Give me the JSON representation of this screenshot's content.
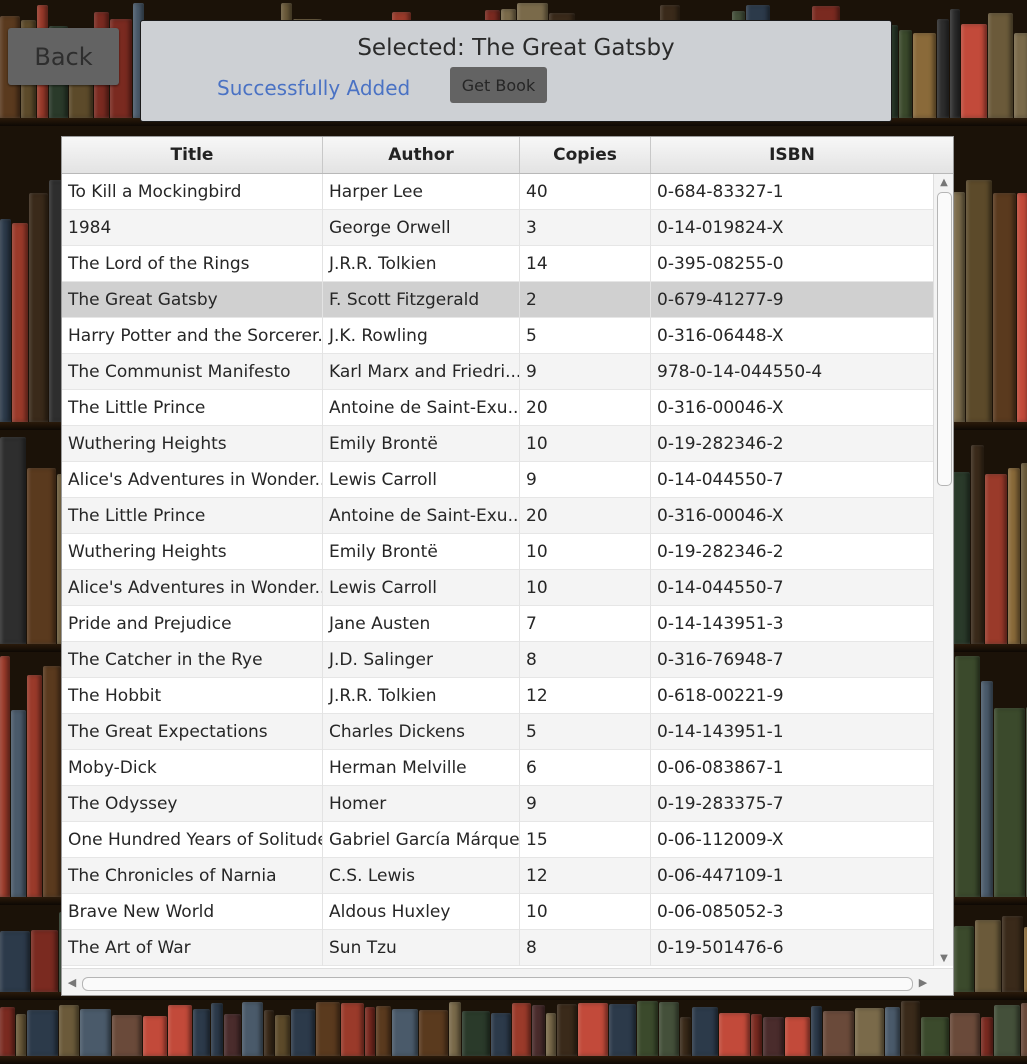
{
  "window": {
    "back_label": "Back",
    "selected_text": "Selected: The Great Gatsby",
    "status_message": "Successfully Added",
    "get_book_label": "Get Book",
    "status_color": "#4a72c4"
  },
  "table": {
    "columns": [
      "Title",
      "Author",
      "Copies",
      "ISBN"
    ],
    "selected_index": 3,
    "rows": [
      {
        "title": "To Kill a Mockingbird",
        "author": "Harper Lee",
        "copies": "40",
        "isbn": "0-684-83327-1"
      },
      {
        "title": "1984",
        "author": "George Orwell",
        "copies": "3",
        "isbn": "0-14-019824-X"
      },
      {
        "title": "The Lord of the Rings",
        "author": "J.R.R. Tolkien",
        "copies": "14",
        "isbn": "0-395-08255-0"
      },
      {
        "title": "The Great Gatsby",
        "author": "F. Scott Fitzgerald",
        "copies": "2",
        "isbn": "0-679-41277-9"
      },
      {
        "title": "Harry Potter and the Sorcerer...",
        "author": "J.K. Rowling",
        "copies": "5",
        "isbn": "0-316-06448-X"
      },
      {
        "title": "The Communist Manifesto",
        "author": "Karl Marx and Friedri...",
        "copies": "9",
        "isbn": "978-0-14-044550-4"
      },
      {
        "title": "The Little Prince",
        "author": "Antoine de Saint-Exu...",
        "copies": "20",
        "isbn": "0-316-00046-X"
      },
      {
        "title": "Wuthering Heights",
        "author": "Emily Brontë",
        "copies": "10",
        "isbn": "0-19-282346-2"
      },
      {
        "title": "Alice's Adventures in Wonder...",
        "author": "Lewis Carroll",
        "copies": "9",
        "isbn": "0-14-044550-7"
      },
      {
        "title": "The Little Prince",
        "author": "Antoine de Saint-Exu...",
        "copies": "20",
        "isbn": "0-316-00046-X"
      },
      {
        "title": "Wuthering Heights",
        "author": "Emily Brontë",
        "copies": "10",
        "isbn": "0-19-282346-2"
      },
      {
        "title": "Alice's Adventures in Wonder...",
        "author": "Lewis Carroll",
        "copies": "10",
        "isbn": "0-14-044550-7"
      },
      {
        "title": "Pride and Prejudice",
        "author": "Jane Austen",
        "copies": "7",
        "isbn": "0-14-143951-3"
      },
      {
        "title": "The Catcher in the Rye",
        "author": "J.D. Salinger",
        "copies": "8",
        "isbn": "0-316-76948-7"
      },
      {
        "title": "The Hobbit",
        "author": "J.R.R. Tolkien",
        "copies": "12",
        "isbn": "0-618-00221-9"
      },
      {
        "title": "The Great Expectations",
        "author": "Charles Dickens",
        "copies": "5",
        "isbn": "0-14-143951-1"
      },
      {
        "title": "Moby-Dick",
        "author": "Herman Melville",
        "copies": "6",
        "isbn": "0-06-083867-1"
      },
      {
        "title": "The Odyssey",
        "author": "Homer",
        "copies": "9",
        "isbn": "0-19-283375-7"
      },
      {
        "title": "One Hundred Years of Solitude",
        "author": "Gabriel García Márquez",
        "copies": "15",
        "isbn": "0-06-112009-X"
      },
      {
        "title": "The Chronicles of Narnia",
        "author": "C.S. Lewis",
        "copies": "12",
        "isbn": "0-06-447109-1"
      },
      {
        "title": "Brave New World",
        "author": "Aldous Huxley",
        "copies": "10",
        "isbn": "0-06-085052-3"
      },
      {
        "title": "The Art of War",
        "author": "Sun Tzu",
        "copies": "8",
        "isbn": "0-19-501476-6"
      }
    ]
  },
  "scrollbars": {
    "up_icon": "▲",
    "down_icon": "▼",
    "left_icon": "◀",
    "right_icon": "▶"
  }
}
